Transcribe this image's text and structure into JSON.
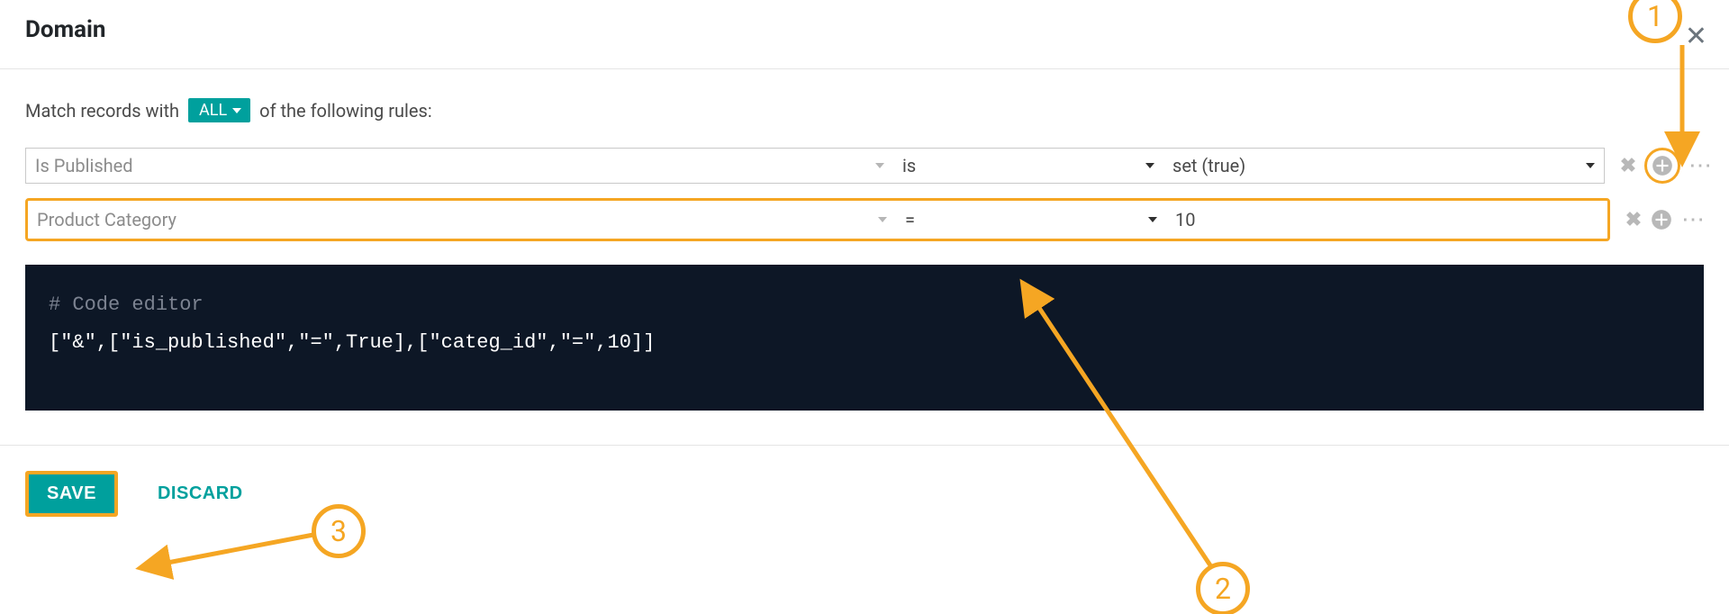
{
  "header": {
    "title": "Domain"
  },
  "intro": {
    "prefix": "Match records with",
    "mode_label": "ALL",
    "suffix": "of the following rules:"
  },
  "rules": [
    {
      "field": "Is Published",
      "operator": "is",
      "value": "set (true)"
    },
    {
      "field": "Product Category",
      "operator": "=",
      "value": "10"
    }
  ],
  "code": {
    "comment": "# Code editor",
    "body": "[\"&\",[\"is_published\",\"=\",True],[\"categ_id\",\"=\",10]]"
  },
  "footer": {
    "save": "SAVE",
    "discard": "DISCARD"
  },
  "annotations": {
    "one": "1",
    "two": "2",
    "three": "3"
  }
}
